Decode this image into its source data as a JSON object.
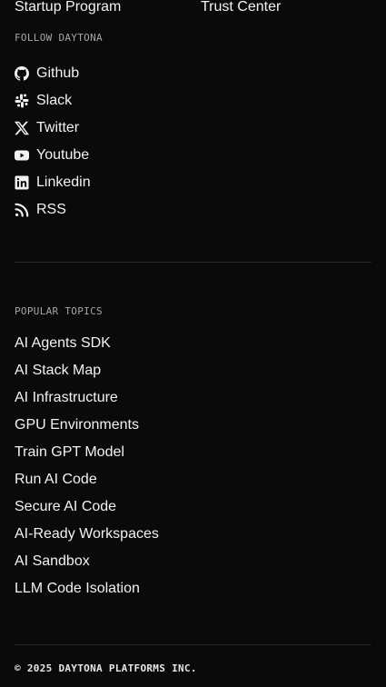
{
  "top_links": {
    "left": "Startup Program",
    "right": "Trust Center"
  },
  "follow": {
    "label": "FOLLOW DAYTONA",
    "items": [
      {
        "label": "Github",
        "icon": "github-icon"
      },
      {
        "label": "Slack",
        "icon": "slack-icon"
      },
      {
        "label": "Twitter",
        "icon": "x-twitter-icon"
      },
      {
        "label": "Youtube",
        "icon": "youtube-icon"
      },
      {
        "label": "Linkedin",
        "icon": "linkedin-icon"
      },
      {
        "label": "RSS",
        "icon": "rss-icon"
      }
    ]
  },
  "topics": {
    "label": "POPULAR TOPICS",
    "items": [
      "AI Agents SDK",
      "AI Stack Map",
      "AI Infrastructure",
      "GPU Environments",
      "Train GPT Model",
      "Run AI Code",
      "Secure AI Code",
      "AI-Ready Workspaces",
      "AI Sandbox",
      "LLM Code Isolation"
    ]
  },
  "footer": {
    "copyright": "© 2025 DAYTONA PLATFORMS INC."
  },
  "colors": {
    "background": "#0a0a0a",
    "text": "#f2f2f2",
    "muted": "#a6a6a6",
    "divider": "#262626"
  }
}
